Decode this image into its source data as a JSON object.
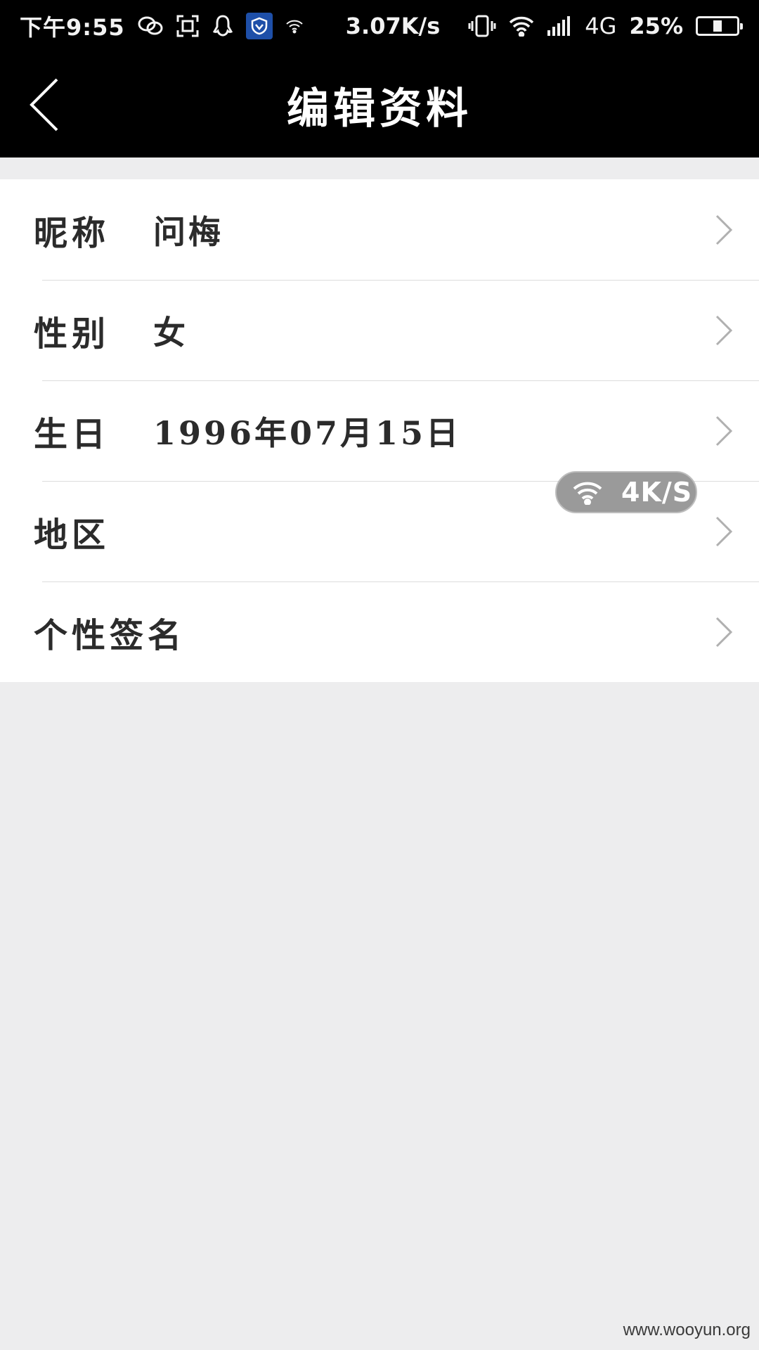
{
  "status_bar": {
    "time": "下午9:55",
    "net_speed": "3.07K/s",
    "network": "4G",
    "battery": "25%",
    "battery_level": 0.25,
    "icons": [
      "chat-icon",
      "screenshot-icon",
      "qq-icon",
      "shield-icon",
      "wifi-icon",
      "vibrate-icon",
      "wifi-icon",
      "signal-icon",
      "battery-icon"
    ]
  },
  "header": {
    "title": "编辑资料",
    "back_icon": "chevron-left-icon"
  },
  "profile": {
    "rows": [
      {
        "label": "昵称",
        "value": "问梅"
      },
      {
        "label": "性别",
        "value": "女"
      },
      {
        "label": "生日",
        "value": "1996年07月15日"
      },
      {
        "label": "地区",
        "value": ""
      },
      {
        "label": "个性签名",
        "value": ""
      }
    ],
    "chevron_icon": "chevron-right-icon"
  },
  "speed_widget": {
    "text": "4K/S",
    "icon": "wifi-icon"
  },
  "watermark": "www.wooyun.org",
  "colors": {
    "bar_bg": "#000000",
    "page_bg": "#ededee",
    "row_bg": "#ffffff",
    "text": "#2b2b2b",
    "shield": "#1e4fa8"
  }
}
